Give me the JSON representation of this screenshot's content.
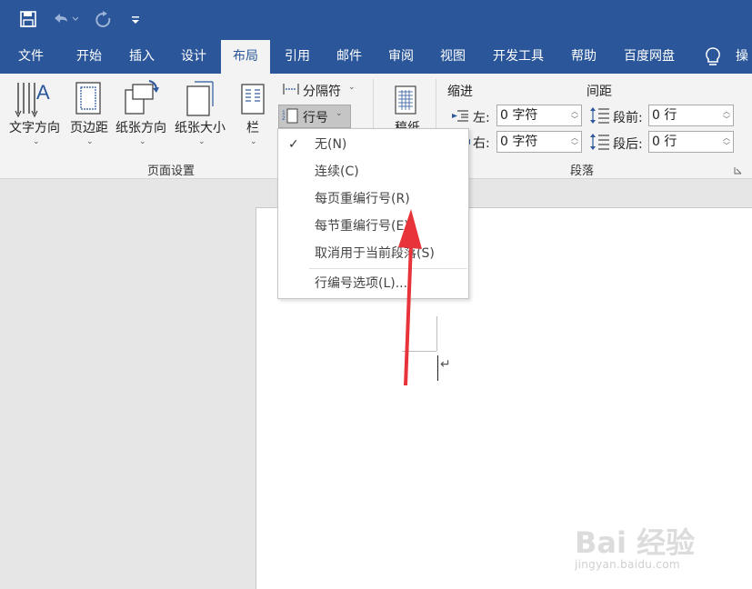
{
  "quick_access": {
    "save_icon": "save-icon",
    "undo_icon": "undo-icon",
    "redo_icon": "redo-icon",
    "customize_icon": "customize-qat-icon"
  },
  "tabs": [
    {
      "label": "文件"
    },
    {
      "label": "开始"
    },
    {
      "label": "插入"
    },
    {
      "label": "设计"
    },
    {
      "label": "布局",
      "active": true
    },
    {
      "label": "引用"
    },
    {
      "label": "邮件"
    },
    {
      "label": "审阅"
    },
    {
      "label": "视图"
    },
    {
      "label": "开发工具"
    },
    {
      "label": "帮助"
    },
    {
      "label": "百度网盘"
    },
    {
      "label": "操"
    }
  ],
  "tell_me_icon": "lightbulb-icon",
  "ribbon": {
    "page_setup": {
      "label": "页面设置",
      "text_direction": "文字方向",
      "margins": "页边距",
      "orientation": "纸张方向",
      "size": "纸张大小",
      "columns": "栏",
      "breaks": "分隔符",
      "line_numbers": "行号"
    },
    "draft_paper": {
      "label": "稿纸"
    },
    "paragraph": {
      "label": "段落",
      "indent_label": "缩进",
      "spacing_label": "间距",
      "left_label": "左:",
      "right_label": "右:",
      "left_value": "0 字符",
      "right_value": "0 字符",
      "before_label": "段前:",
      "after_label": "段后:",
      "before_value": "0 行",
      "after_value": "0 行"
    }
  },
  "menu": {
    "items": [
      {
        "label": "无(N)",
        "checked": true
      },
      {
        "label": "连续(C)"
      },
      {
        "label": "每页重编行号(R)"
      },
      {
        "label": "每节重编行号(E)"
      },
      {
        "label": "取消用于当前段落(S)"
      },
      {
        "label": "行编号选项(L)..."
      }
    ]
  },
  "document": {
    "paragraph_mark": "↵"
  },
  "watermark": {
    "main": "Bai 经验",
    "url": "jingyan.baidu.com"
  },
  "colors": {
    "title_bar": "#2b579a",
    "ribbon": "#f3f3f3",
    "annotation_arrow": "#e8333a"
  }
}
